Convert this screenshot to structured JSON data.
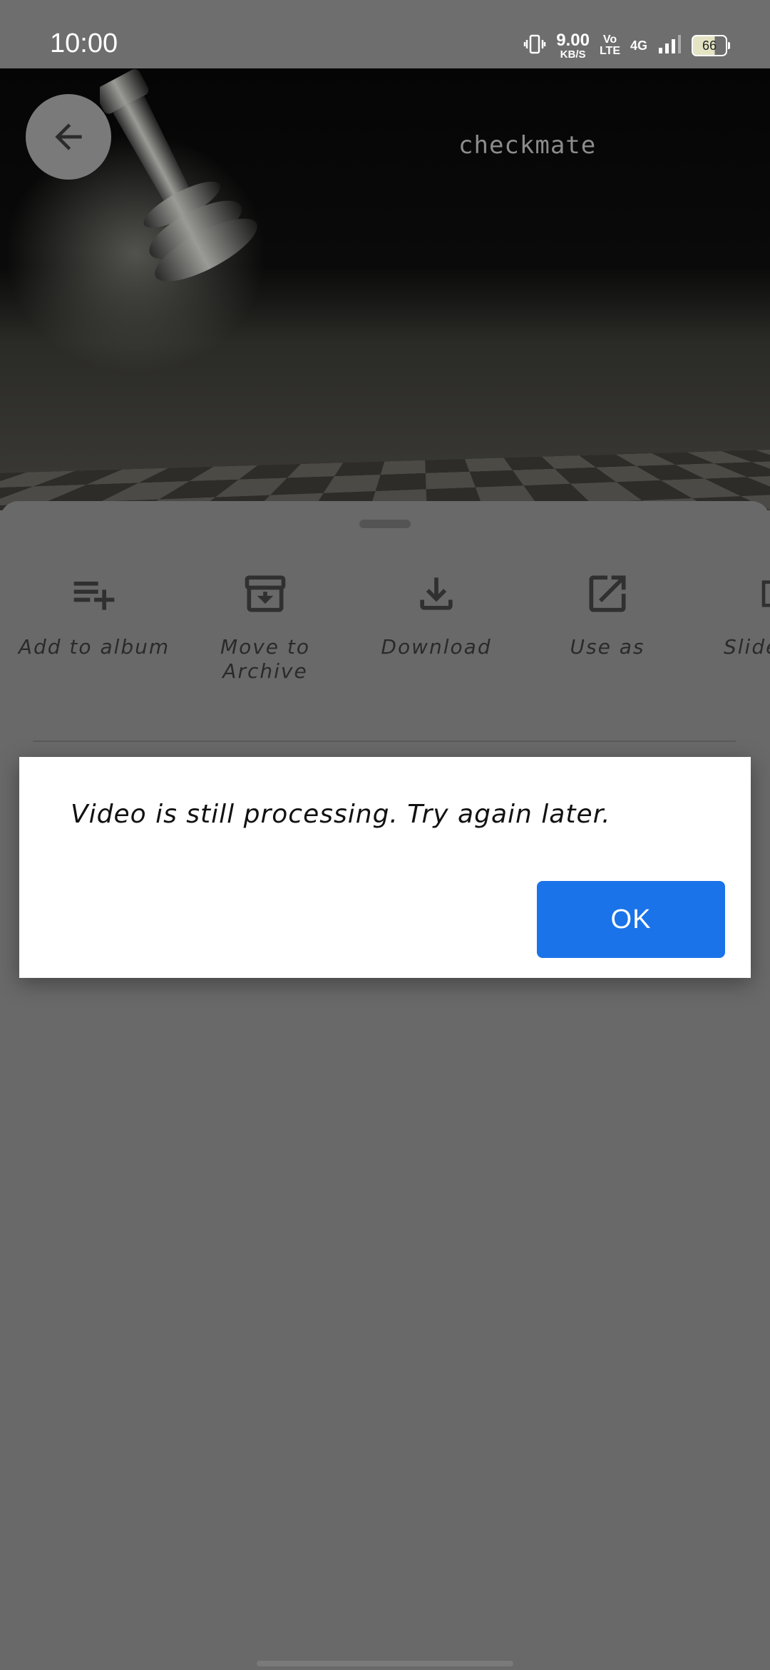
{
  "status_bar": {
    "time": "10:00",
    "speed_value": "9.00",
    "speed_unit": "KB/S",
    "volte_top": "Vo",
    "volte_bottom": "LTE",
    "network": "4G",
    "battery": "66"
  },
  "photo": {
    "caption": "checkmate"
  },
  "actions": [
    {
      "label": "Add to album",
      "icon": "playlist-add-icon"
    },
    {
      "label": "Move to Archive",
      "icon": "archive-icon"
    },
    {
      "label": "Download",
      "icon": "download-icon"
    },
    {
      "label": "Use as",
      "icon": "open-external-icon"
    },
    {
      "label": "Slide",
      "icon": "slideshow-icon"
    }
  ],
  "dialog": {
    "message": "Video is still processing. Try again later.",
    "ok_label": "OK"
  },
  "colors": {
    "accent": "#1a73e8",
    "scrim": "#696969",
    "dialog_bg": "#ffffff"
  }
}
